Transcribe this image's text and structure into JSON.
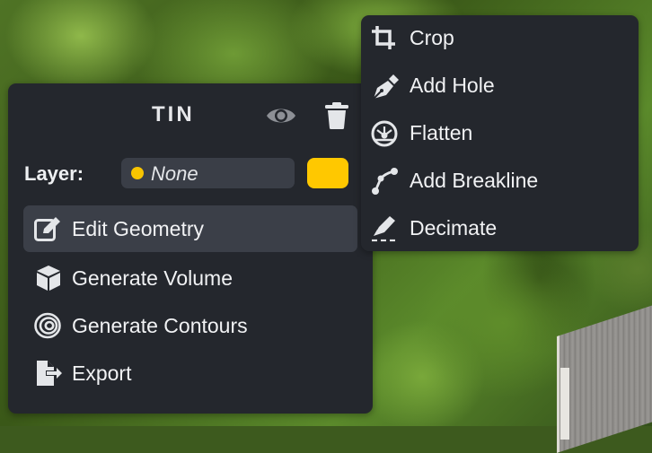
{
  "colors": {
    "panel_bg": "#24272d",
    "hover_bg": "#3b3f48",
    "text": "#f1f2f4",
    "layer_dot": "#f7c400",
    "swatch": "#ffc800"
  },
  "tin_panel": {
    "title": "TIN",
    "visibility_icon": "eye-icon",
    "delete_icon": "trash-icon",
    "layer": {
      "label": "Layer:",
      "value": "None"
    },
    "actions": [
      {
        "label": "Edit Geometry",
        "icon": "edit-icon",
        "active": true
      },
      {
        "label": "Generate Volume",
        "icon": "cube-icon",
        "active": false
      },
      {
        "label": "Generate Contours",
        "icon": "contours-icon",
        "active": false
      },
      {
        "label": "Export",
        "icon": "export-icon",
        "active": false
      }
    ]
  },
  "geometry_menu": {
    "items": [
      {
        "label": "Crop",
        "icon": "crop-icon"
      },
      {
        "label": "Add Hole",
        "icon": "pen-icon"
      },
      {
        "label": "Flatten",
        "icon": "flatten-icon"
      },
      {
        "label": "Add Breakline",
        "icon": "breakline-icon"
      },
      {
        "label": "Decimate",
        "icon": "decimate-icon"
      }
    ]
  }
}
